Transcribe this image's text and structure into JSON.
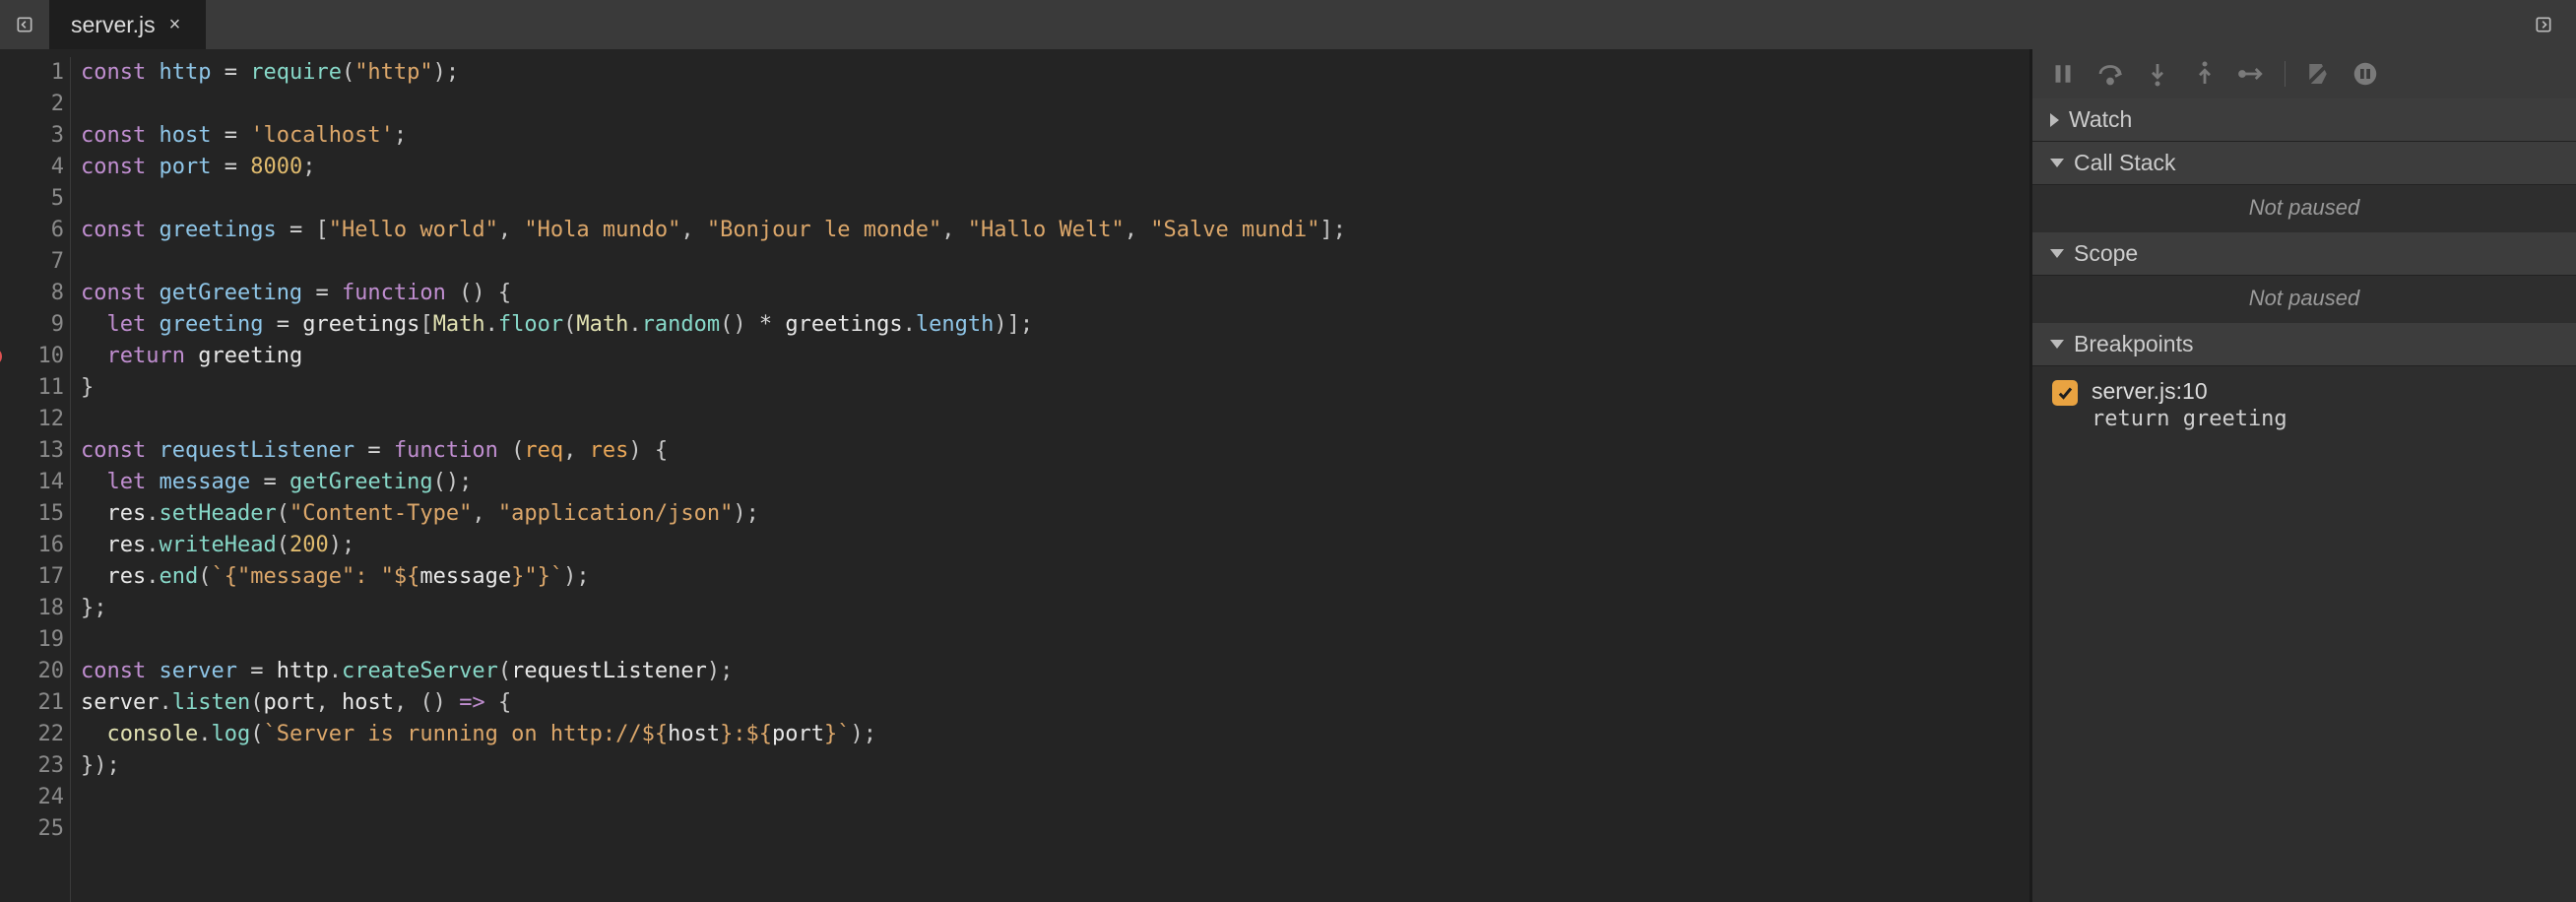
{
  "tab": {
    "filename": "server.js"
  },
  "editor": {
    "breakpoint_line": 10,
    "lines": [
      [
        {
          "c": "kw",
          "t": "const"
        },
        {
          "c": "op",
          "t": " "
        },
        {
          "c": "var",
          "t": "http"
        },
        {
          "c": "op",
          "t": " "
        },
        {
          "c": "op",
          "t": "="
        },
        {
          "c": "op",
          "t": " "
        },
        {
          "c": "call",
          "t": "require"
        },
        {
          "c": "pun",
          "t": "("
        },
        {
          "c": "str",
          "t": "\"http\""
        },
        {
          "c": "pun",
          "t": ")"
        },
        {
          "c": "pun",
          "t": ";"
        }
      ],
      [],
      [
        {
          "c": "kw",
          "t": "const"
        },
        {
          "c": "op",
          "t": " "
        },
        {
          "c": "var",
          "t": "host"
        },
        {
          "c": "op",
          "t": " "
        },
        {
          "c": "op",
          "t": "="
        },
        {
          "c": "op",
          "t": " "
        },
        {
          "c": "str",
          "t": "'localhost'"
        },
        {
          "c": "pun",
          "t": ";"
        }
      ],
      [
        {
          "c": "kw",
          "t": "const"
        },
        {
          "c": "op",
          "t": " "
        },
        {
          "c": "var",
          "t": "port"
        },
        {
          "c": "op",
          "t": " "
        },
        {
          "c": "op",
          "t": "="
        },
        {
          "c": "op",
          "t": " "
        },
        {
          "c": "num",
          "t": "8000"
        },
        {
          "c": "pun",
          "t": ";"
        }
      ],
      [],
      [
        {
          "c": "kw",
          "t": "const"
        },
        {
          "c": "op",
          "t": " "
        },
        {
          "c": "var",
          "t": "greetings"
        },
        {
          "c": "op",
          "t": " "
        },
        {
          "c": "op",
          "t": "="
        },
        {
          "c": "op",
          "t": " "
        },
        {
          "c": "pun",
          "t": "["
        },
        {
          "c": "str",
          "t": "\"Hello world\""
        },
        {
          "c": "pun",
          "t": ", "
        },
        {
          "c": "str",
          "t": "\"Hola mundo\""
        },
        {
          "c": "pun",
          "t": ", "
        },
        {
          "c": "str",
          "t": "\"Bonjour le monde\""
        },
        {
          "c": "pun",
          "t": ", "
        },
        {
          "c": "str",
          "t": "\"Hallo Welt\""
        },
        {
          "c": "pun",
          "t": ", "
        },
        {
          "c": "str",
          "t": "\"Salve mundi\""
        },
        {
          "c": "pun",
          "t": "]"
        },
        {
          "c": "pun",
          "t": ";"
        }
      ],
      [],
      [
        {
          "c": "kw",
          "t": "const"
        },
        {
          "c": "op",
          "t": " "
        },
        {
          "c": "var",
          "t": "getGreeting"
        },
        {
          "c": "op",
          "t": " "
        },
        {
          "c": "op",
          "t": "="
        },
        {
          "c": "op",
          "t": " "
        },
        {
          "c": "kw",
          "t": "function"
        },
        {
          "c": "op",
          "t": " "
        },
        {
          "c": "pun",
          "t": "()"
        },
        {
          "c": "op",
          "t": " "
        },
        {
          "c": "pun",
          "t": "{"
        }
      ],
      [
        {
          "c": "op",
          "t": "  "
        },
        {
          "c": "kw",
          "t": "let"
        },
        {
          "c": "op",
          "t": " "
        },
        {
          "c": "var",
          "t": "greeting"
        },
        {
          "c": "op",
          "t": " "
        },
        {
          "c": "op",
          "t": "="
        },
        {
          "c": "op",
          "t": " "
        },
        {
          "c": "varw",
          "t": "greetings"
        },
        {
          "c": "pun",
          "t": "["
        },
        {
          "c": "obj",
          "t": "Math"
        },
        {
          "c": "pun",
          "t": "."
        },
        {
          "c": "call",
          "t": "floor"
        },
        {
          "c": "pun",
          "t": "("
        },
        {
          "c": "obj",
          "t": "Math"
        },
        {
          "c": "pun",
          "t": "."
        },
        {
          "c": "call",
          "t": "random"
        },
        {
          "c": "pun",
          "t": "()"
        },
        {
          "c": "op",
          "t": " * "
        },
        {
          "c": "varw",
          "t": "greetings"
        },
        {
          "c": "pun",
          "t": "."
        },
        {
          "c": "var",
          "t": "length"
        },
        {
          "c": "pun",
          "t": ")"
        },
        {
          "c": "pun",
          "t": "]"
        },
        {
          "c": "pun",
          "t": ";"
        }
      ],
      [
        {
          "c": "op",
          "t": "  "
        },
        {
          "c": "kw",
          "t": "return"
        },
        {
          "c": "op",
          "t": " "
        },
        {
          "c": "varw",
          "t": "greeting"
        }
      ],
      [
        {
          "c": "pun",
          "t": "}"
        }
      ],
      [],
      [
        {
          "c": "kw",
          "t": "const"
        },
        {
          "c": "op",
          "t": " "
        },
        {
          "c": "var",
          "t": "requestListener"
        },
        {
          "c": "op",
          "t": " "
        },
        {
          "c": "op",
          "t": "="
        },
        {
          "c": "op",
          "t": " "
        },
        {
          "c": "kw",
          "t": "function"
        },
        {
          "c": "op",
          "t": " "
        },
        {
          "c": "pun",
          "t": "("
        },
        {
          "c": "prm",
          "t": "req"
        },
        {
          "c": "pun",
          "t": ", "
        },
        {
          "c": "prm",
          "t": "res"
        },
        {
          "c": "pun",
          "t": ")"
        },
        {
          "c": "op",
          "t": " "
        },
        {
          "c": "pun",
          "t": "{"
        }
      ],
      [
        {
          "c": "op",
          "t": "  "
        },
        {
          "c": "kw",
          "t": "let"
        },
        {
          "c": "op",
          "t": " "
        },
        {
          "c": "var",
          "t": "message"
        },
        {
          "c": "op",
          "t": " "
        },
        {
          "c": "op",
          "t": "="
        },
        {
          "c": "op",
          "t": " "
        },
        {
          "c": "call",
          "t": "getGreeting"
        },
        {
          "c": "pun",
          "t": "();"
        }
      ],
      [
        {
          "c": "op",
          "t": "  "
        },
        {
          "c": "varw",
          "t": "res"
        },
        {
          "c": "pun",
          "t": "."
        },
        {
          "c": "call",
          "t": "setHeader"
        },
        {
          "c": "pun",
          "t": "("
        },
        {
          "c": "str",
          "t": "\"Content-Type\""
        },
        {
          "c": "pun",
          "t": ", "
        },
        {
          "c": "str",
          "t": "\"application/json\""
        },
        {
          "c": "pun",
          "t": ");"
        }
      ],
      [
        {
          "c": "op",
          "t": "  "
        },
        {
          "c": "varw",
          "t": "res"
        },
        {
          "c": "pun",
          "t": "."
        },
        {
          "c": "call",
          "t": "writeHead"
        },
        {
          "c": "pun",
          "t": "("
        },
        {
          "c": "num",
          "t": "200"
        },
        {
          "c": "pun",
          "t": ");"
        }
      ],
      [
        {
          "c": "op",
          "t": "  "
        },
        {
          "c": "varw",
          "t": "res"
        },
        {
          "c": "pun",
          "t": "."
        },
        {
          "c": "call",
          "t": "end"
        },
        {
          "c": "pun",
          "t": "("
        },
        {
          "c": "str",
          "t": "`{\"message\": \"${"
        },
        {
          "c": "varw",
          "t": "message"
        },
        {
          "c": "str",
          "t": "}\"}`"
        },
        {
          "c": "pun",
          "t": ");"
        }
      ],
      [
        {
          "c": "pun",
          "t": "};"
        }
      ],
      [],
      [
        {
          "c": "kw",
          "t": "const"
        },
        {
          "c": "op",
          "t": " "
        },
        {
          "c": "var",
          "t": "server"
        },
        {
          "c": "op",
          "t": " "
        },
        {
          "c": "op",
          "t": "="
        },
        {
          "c": "op",
          "t": " "
        },
        {
          "c": "varw",
          "t": "http"
        },
        {
          "c": "pun",
          "t": "."
        },
        {
          "c": "call",
          "t": "createServer"
        },
        {
          "c": "pun",
          "t": "("
        },
        {
          "c": "varw",
          "t": "requestListener"
        },
        {
          "c": "pun",
          "t": ");"
        }
      ],
      [
        {
          "c": "varw",
          "t": "server"
        },
        {
          "c": "pun",
          "t": "."
        },
        {
          "c": "call",
          "t": "listen"
        },
        {
          "c": "pun",
          "t": "("
        },
        {
          "c": "varw",
          "t": "port"
        },
        {
          "c": "pun",
          "t": ", "
        },
        {
          "c": "varw",
          "t": "host"
        },
        {
          "c": "pun",
          "t": ", "
        },
        {
          "c": "pun",
          "t": "()"
        },
        {
          "c": "op",
          "t": " "
        },
        {
          "c": "kw",
          "t": "=>"
        },
        {
          "c": "op",
          "t": " "
        },
        {
          "c": "pun",
          "t": "{"
        }
      ],
      [
        {
          "c": "op",
          "t": "  "
        },
        {
          "c": "obj",
          "t": "console"
        },
        {
          "c": "pun",
          "t": "."
        },
        {
          "c": "call",
          "t": "log"
        },
        {
          "c": "pun",
          "t": "("
        },
        {
          "c": "str",
          "t": "`Server is running on http://${"
        },
        {
          "c": "varw",
          "t": "host"
        },
        {
          "c": "str",
          "t": "}:${"
        },
        {
          "c": "varw",
          "t": "port"
        },
        {
          "c": "str",
          "t": "}`"
        },
        {
          "c": "pun",
          "t": ");"
        }
      ],
      [
        {
          "c": "pun",
          "t": "});"
        }
      ],
      [],
      []
    ]
  },
  "debug": {
    "watch": {
      "title": "Watch"
    },
    "callstack": {
      "title": "Call Stack",
      "status": "Not paused"
    },
    "scope": {
      "title": "Scope",
      "status": "Not paused"
    },
    "breakpoints": {
      "title": "Breakpoints",
      "items": [
        {
          "checked": true,
          "location": "server.js:10",
          "source": "return greeting"
        }
      ]
    }
  }
}
